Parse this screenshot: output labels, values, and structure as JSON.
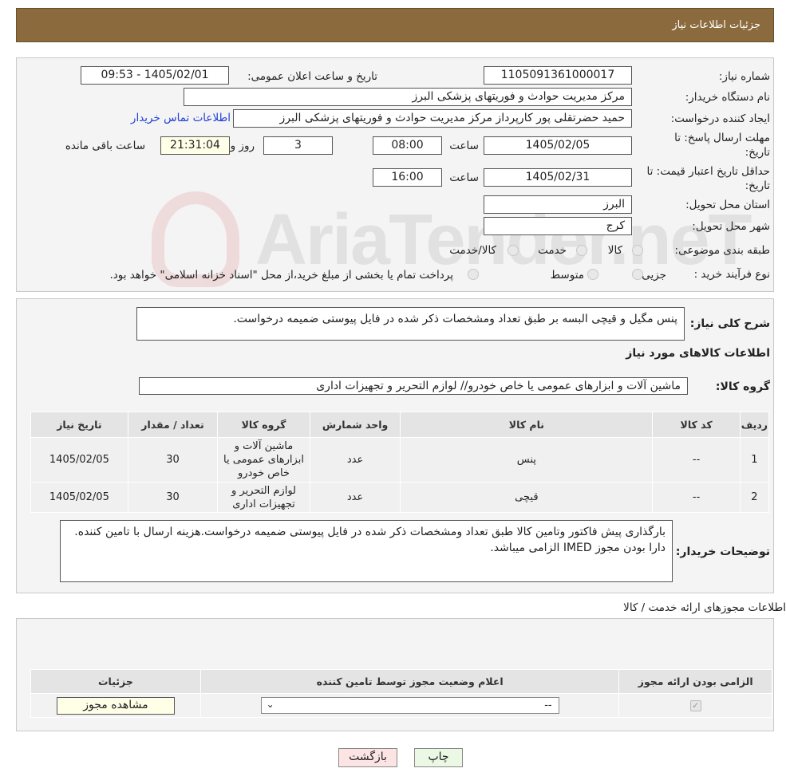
{
  "header": {
    "title": "جزئیات اطلاعات نیاز"
  },
  "form": {
    "need_number_label": "شماره نیاز:",
    "need_number": "1105091361000017",
    "announce_label": "تاریخ و ساعت اعلان عمومی:",
    "announce_value": "1405/02/01 - 09:53",
    "buyer_org_label": "نام دستگاه خریدار:",
    "buyer_org": "مرکز مدیریت حوادث و فوریتهای پزشکی البرز",
    "creator_label": "ایجاد کننده درخواست:",
    "creator": "حمید حضرتقلی پور کارپرداز  مرکز مدیریت حوادث و فوریتهای پزشکی البرز",
    "contact_link": "اطلاعات تماس خریدار",
    "deadline_label_1": "مهلت ارسال پاسخ: تا",
    "deadline_label_2": "تاریخ:",
    "deadline_date": "1405/02/05",
    "time_label": "ساعت",
    "deadline_time": "08:00",
    "days_value": "3",
    "days_label": "روز و",
    "remaining_time": "21:31:04",
    "remaining_label": "ساعت باقی مانده",
    "validity_label_1": "حداقل تاریخ اعتبار قیمت: تا",
    "validity_label_2": "تاریخ:",
    "validity_date": "1405/02/31",
    "validity_time": "16:00",
    "province_label": "استان محل تحویل:",
    "province": "البرز",
    "city_label": "شهر محل تحویل:",
    "city": "کرج",
    "category_label": "طبقه بندی موضوعی:",
    "category_options": [
      "کالا",
      "خدمت",
      "کالا/خدمت"
    ],
    "process_label": "نوع فرآیند خرید :",
    "process_options": [
      "جزیی",
      "متوسط"
    ],
    "process_note": "پرداخت تمام یا بخشی از مبلغ خرید،از محل \"اسناد خزانه اسلامی\" خواهد بود."
  },
  "summary": {
    "desc_label": "شرح کلی نیاز:",
    "desc": "پنس مگیل و قیچی البسه بر طبق تعداد ومشخصات ذکر شده در فایل پیوستی ضمیمه درخواست.",
    "goods_title": "اطلاعات کالاهای مورد نیاز",
    "group_label": "گروه کالا:",
    "group_value": "ماشین آلات و ابزارهای عمومی یا خاص خودرو// لوازم التحریر و تجهیزات اداری"
  },
  "items_table": {
    "headers": [
      "ردیف",
      "کد کالا",
      "نام کالا",
      "واحد شمارش",
      "گروه کالا",
      "تعداد / مقدار",
      "تاریخ نیاز"
    ],
    "rows": [
      {
        "row": "1",
        "code": "--",
        "name": "پنس",
        "unit": "عدد",
        "group": "ماشین آلات و ابزارهای عمومی یا خاص خودرو",
        "qty": "30",
        "date": "1405/02/05"
      },
      {
        "row": "2",
        "code": "--",
        "name": "قیچی",
        "unit": "عدد",
        "group": "لوازم التحریر و تجهیزات اداری",
        "qty": "30",
        "date": "1405/02/05"
      }
    ]
  },
  "buyer_notes": {
    "label": "توضیحات خریدار:",
    "text": "بارگذاری پیش فاکتور وتامین کالا طبق تعداد ومشخصات ذکر شده در فایل پیوستی ضمیمه درخواست.هزینه ارسال با تامین کننده. دارا بودن مجوز IMED الزامی میباشد."
  },
  "licenses": {
    "section_title": "اطلاعات مجوزهای ارائه خدمت / کالا",
    "headers": [
      "الزامی بودن ارائه مجوز",
      "اعلام وضعیت مجوز توسط تامین کننده",
      "جزئیات"
    ],
    "select_value": "--",
    "view_button": "مشاهده مجوز"
  },
  "footer": {
    "print_label": "چاپ",
    "back_label": "بازگشت"
  },
  "watermark": {
    "text": "AriaTender.neT"
  },
  "colors": {
    "header_bg": "#8b6a3e",
    "link": "#1f3fd6",
    "back_button": "#fde4e4",
    "print_button": "#eaf8e4"
  }
}
